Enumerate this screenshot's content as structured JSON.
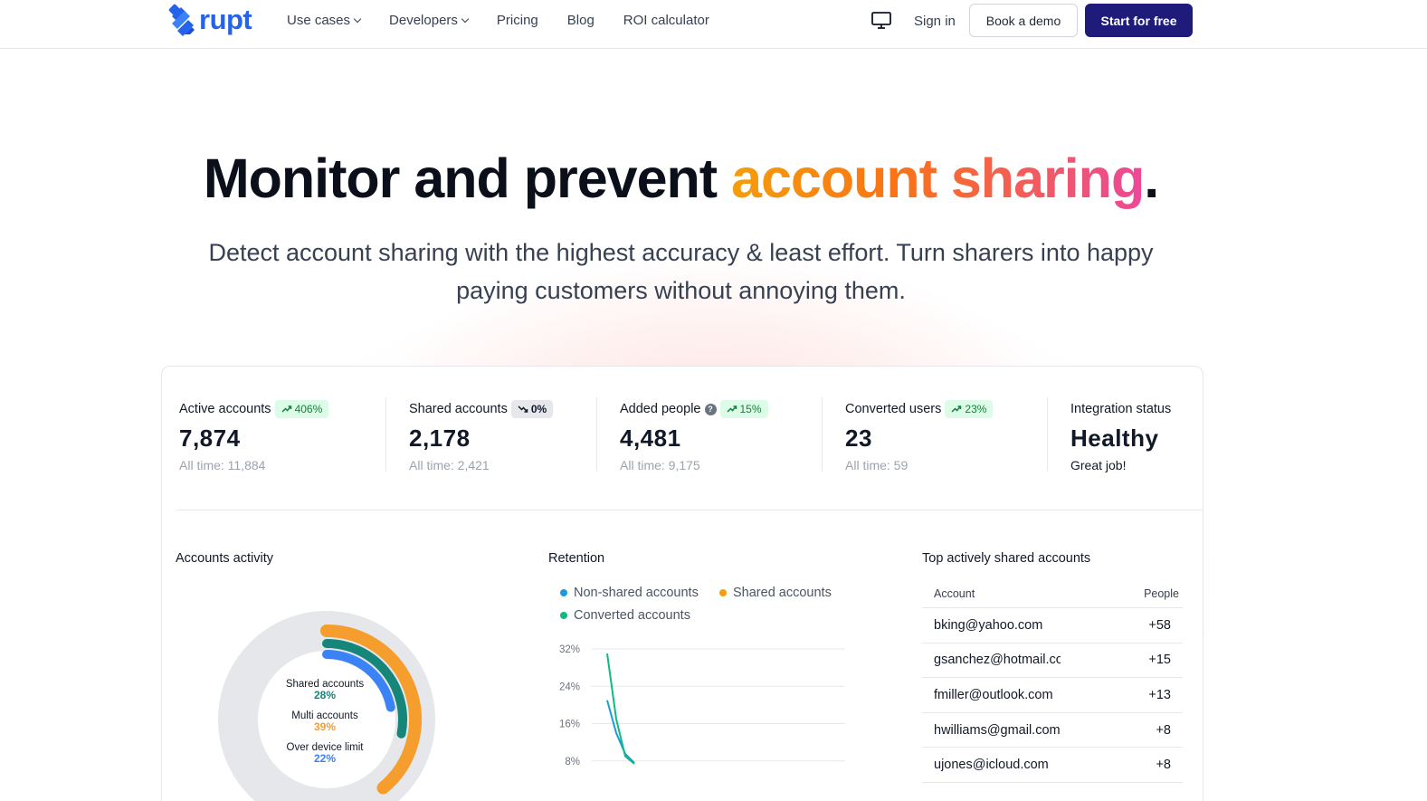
{
  "nav": {
    "logo_text": "rupt",
    "links": [
      {
        "label": "Use cases",
        "dropdown": true
      },
      {
        "label": "Developers",
        "dropdown": true
      },
      {
        "label": "Pricing"
      },
      {
        "label": "Blog"
      },
      {
        "label": "ROI calculator"
      }
    ],
    "sign_in": "Sign in",
    "book_demo": "Book a demo",
    "start_free": "Start for free"
  },
  "hero": {
    "title_start": "Monitor and prevent ",
    "title_accent": "account sharing",
    "title_end": ".",
    "subtitle": "Detect account sharing with the highest accuracy & least effort. Turn sharers into happy paying customers without annoying them."
  },
  "stats": [
    {
      "label": "Active accounts",
      "change": "406%",
      "trend": "up",
      "value": "7,874",
      "foot": "All time: 11,884"
    },
    {
      "label": "Shared accounts",
      "change": "0%",
      "trend": "flat",
      "value": "2,178",
      "foot": "All time: 2,421"
    },
    {
      "label": "Added people",
      "change": "15%",
      "trend": "up",
      "value": "4,481",
      "foot": "All time: 9,175",
      "help": "?"
    },
    {
      "label": "Converted users",
      "change": "23%",
      "trend": "up",
      "value": "23",
      "foot": "All time: 59"
    },
    {
      "label": "Integration status",
      "value": "Healthy",
      "foot": "Great job!"
    }
  ],
  "activity": {
    "title": "Accounts activity",
    "segments": [
      {
        "label": "Shared accounts",
        "value": "28%",
        "percent": 28,
        "color": "#16857a"
      },
      {
        "label": "Multi accounts",
        "value": "39%",
        "percent": 39,
        "color": "#f59e2e"
      },
      {
        "label": "Over device limit",
        "value": "22%",
        "percent": 22,
        "color": "#3b82f6"
      }
    ]
  },
  "retention": {
    "title": "Retention",
    "legend": [
      {
        "label": "Non-shared accounts",
        "color": "#1d9bd7"
      },
      {
        "label": "Shared accounts",
        "color": "#f59e0b"
      },
      {
        "label": "Converted accounts",
        "color": "#10b981"
      }
    ]
  },
  "chart_data": {
    "type": "line",
    "title": "Retention",
    "y_ticks": [
      "32%",
      "24%",
      "16%",
      "8%"
    ],
    "ylim": [
      0,
      32
    ],
    "grid": true,
    "legend_position": "top",
    "series": [
      {
        "name": "Non-shared accounts",
        "color": "#1d9bd7",
        "points": [
          [
            0,
            21
          ],
          [
            1,
            14
          ],
          [
            2,
            9.5
          ],
          [
            3,
            7.6
          ]
        ]
      },
      {
        "name": "Converted accounts",
        "color": "#10b981",
        "points": [
          [
            0,
            31
          ],
          [
            1,
            17
          ],
          [
            2,
            9
          ],
          [
            3,
            7.4
          ]
        ]
      }
    ]
  },
  "top_shared": {
    "title": "Top actively shared accounts",
    "headers": [
      "Account",
      "People"
    ],
    "rows": [
      {
        "account": "bking@yahoo.com",
        "people": "+58"
      },
      {
        "account": "gsanchez@hotmail.com",
        "people": "+15"
      },
      {
        "account": "fmiller@outlook.com",
        "people": "+13"
      },
      {
        "account": "hwilliams@gmail.com",
        "people": "+8"
      },
      {
        "account": "ujones@icloud.com",
        "people": "+8"
      }
    ]
  }
}
